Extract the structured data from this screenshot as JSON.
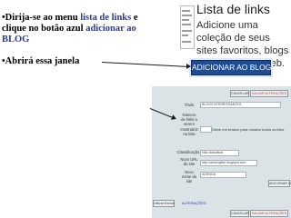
{
  "instructions": {
    "line1_pre": "•Dirija-se ao menu ",
    "line1_link": "lista de links",
    "line1_post": " e",
    "line2_pre": "clique no botão azul ",
    "line2_link": "adicionar ao",
    "line3_link": "BLOG",
    "line4": "•Abrirá essa  janela"
  },
  "panel": {
    "title": "Lista de links",
    "description": "Adicione uma coleção de seus sites favoritos, blogs ou páginas na web.",
    "add_button": "ADICIONAR AO BLOG"
  },
  "form": {
    "cancel_top": "CANCELAR",
    "save_top": "SALVAR ALTERAÇÕES",
    "title_label": "Título",
    "title_value": "BLOGS INTERESSANTES",
    "count_label": "Número de links a serem mostrados na lista",
    "count_hint": "Deixe em branco para mostrar todos os links",
    "sort_label": "Classificação",
    "sort_value": "Não classificar",
    "new_url_label": "Novo URL do site",
    "new_url_value": "http://aesenglish.blogspot.com",
    "new_name_label": "Novo nome do site",
    "new_name_value": "ADENGA",
    "add_link_button": "ADICIONAR LINK",
    "remove_button": "Utilizar Excluir",
    "view_changes": "ALTERAÇÕES",
    "cancel_bottom": "CANCELAR",
    "save_bottom": "SALVAR ALTERAÇÕES"
  },
  "colors": {
    "accent_link": "#2a3a9c",
    "button_blue": "#1f4d95",
    "form_bg": "#dbe3e7"
  }
}
